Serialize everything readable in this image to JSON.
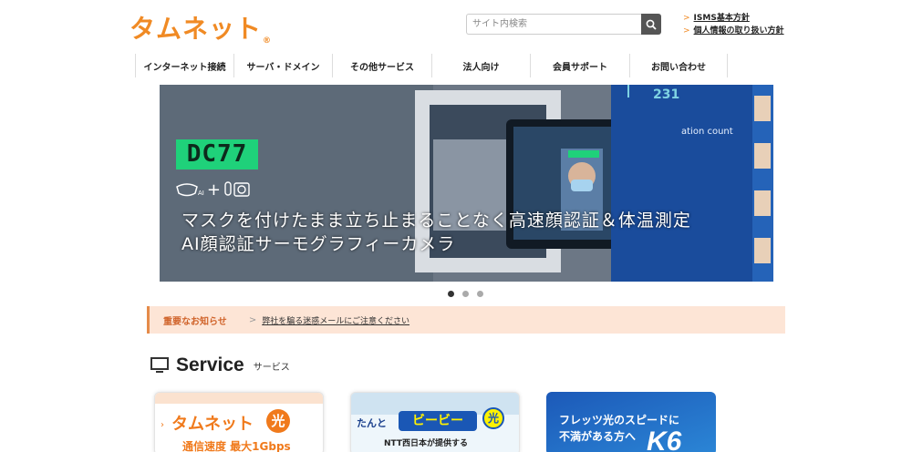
{
  "brand": {
    "logo_text": "タムネット",
    "logo_mark": "®",
    "accent": "#f08a24"
  },
  "search": {
    "placeholder": "サイト内検索",
    "icon": "search-icon"
  },
  "toplinks": [
    {
      "arrow": ">",
      "label": "ISMS基本方針"
    },
    {
      "arrow": ">",
      "label": "個人情報の取り扱い方針"
    }
  ],
  "gnav": [
    {
      "label": "インターネット接続"
    },
    {
      "label": "サーバ・ドメイン"
    },
    {
      "label": "その他サービス"
    },
    {
      "label": "法人向け"
    },
    {
      "label": "会員サポート"
    },
    {
      "label": "お問い合わせ"
    }
  ],
  "hero": {
    "badge": "DC77",
    "icon_plus": "+",
    "icon_ai": "AI",
    "line1": "マスクを付けたまま立ち止まることなく高速顔認証＆体温測定",
    "line2": "AI顔認証サーモグラフィーカメラ",
    "counter": "231",
    "count_label": "ation count",
    "slides": 3,
    "active_slide": 1
  },
  "notice": {
    "title": "重要なお知らせ",
    "arrow": ">",
    "link": "弊社を騙る迷惑メールにご注意ください"
  },
  "service": {
    "title_en": "Service",
    "title_ja": "サービス",
    "icon": "monitor-icon",
    "cards": [
      {
        "brand": "タムネット",
        "badge": "光",
        "sub": "通信速度 最大1Gbps"
      },
      {
        "prefix": "たんと",
        "brand": "ビービー",
        "badge": "光",
        "sub": "NTT西日本が提供する"
      },
      {
        "line1": "フレッツ光のスピードに",
        "line2": "不満がある方へ",
        "mark": "K6"
      }
    ]
  }
}
